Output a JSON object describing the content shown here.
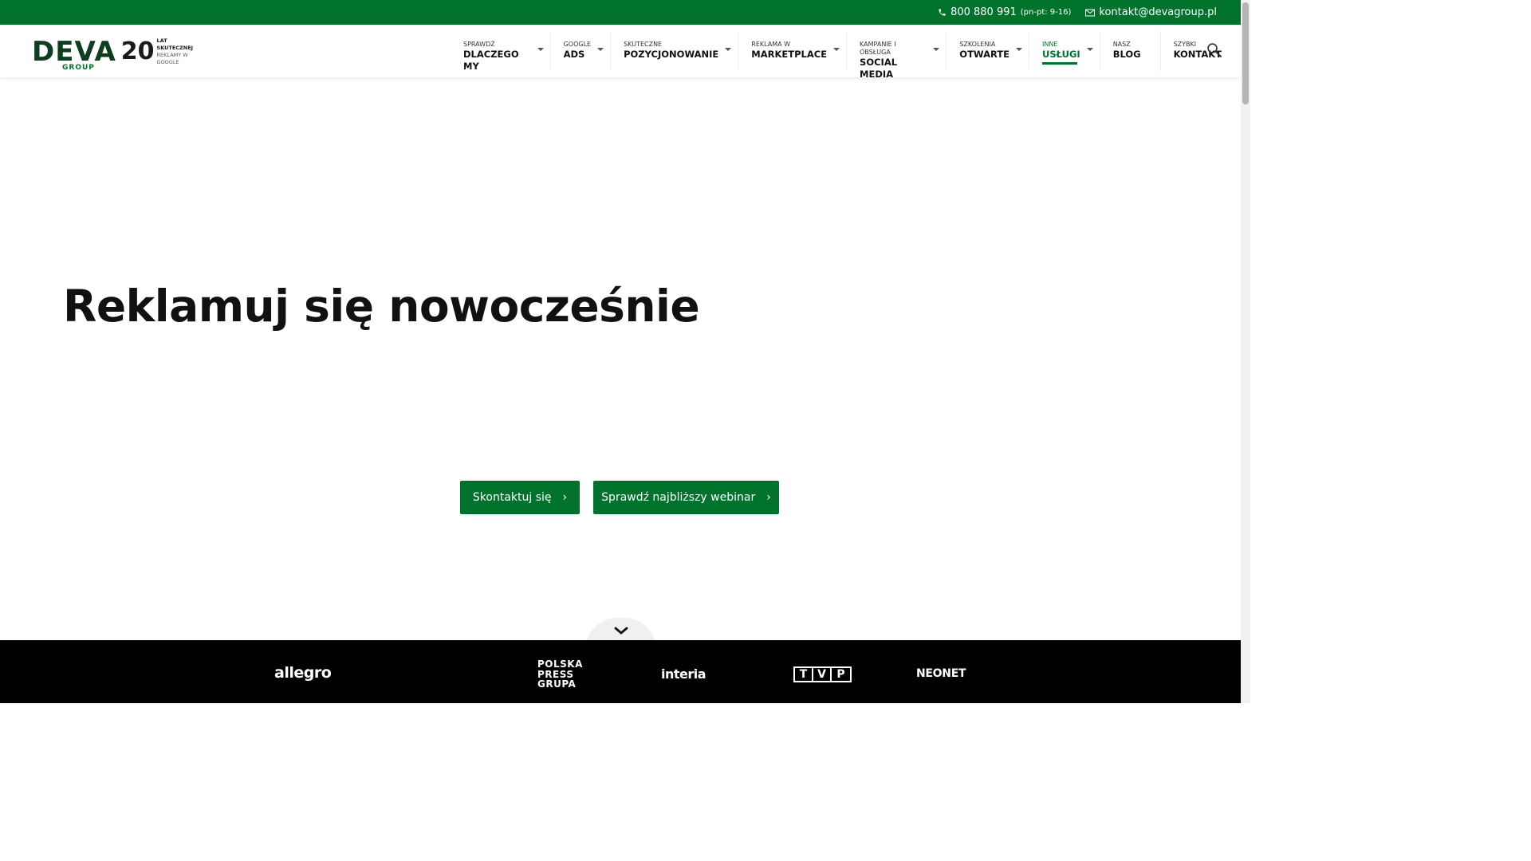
{
  "topbar": {
    "phone": "800 880 991",
    "phone_hours": "(pn-pt: 9-16)",
    "email": "kontakt@devagroup.pl"
  },
  "logo": {
    "brand": "DEVA",
    "group": "GROUP",
    "number": "20",
    "tagline_top": "LAT SKUTECZNEJ",
    "tagline_bottom": "REKLAMY W GOOGLE"
  },
  "nav": [
    {
      "top": "SPRAWDŹ",
      "main": "DLACZEGO MY"
    },
    {
      "top": "GOOGLE",
      "main": "ADS"
    },
    {
      "top": "SKUTECZNE",
      "main": "POZYCJONOWANIE"
    },
    {
      "top": "REKLAMA W",
      "main": "MARKETPLACE"
    },
    {
      "top": "KAMPANIE I OBSŁUGA",
      "main": "SOCIAL MEDIA"
    },
    {
      "top": "SZKOLENIA",
      "main": "OTWARTE"
    },
    {
      "top": "INNE",
      "main": "USŁUGI"
    },
    {
      "top": "NASZ",
      "main": "BLOG"
    },
    {
      "top": "SZYBKI",
      "main": "KONTAKT"
    }
  ],
  "hero": {
    "title": "Reklamuj się nowocześnie",
    "btn_contact": "Skontaktuj się",
    "btn_webinar": "Sprawdź najbliższy webinar"
  },
  "clients": {
    "allegro": "allegro",
    "ppg": [
      "POLSKA",
      "PRESS",
      "GRUPA"
    ],
    "interia": "interia",
    "tvp": [
      "T",
      "V",
      "P"
    ],
    "neonet": "NEONET"
  },
  "colors": {
    "brand_green": "#00722b",
    "dark_green": "#0f3d1f"
  }
}
